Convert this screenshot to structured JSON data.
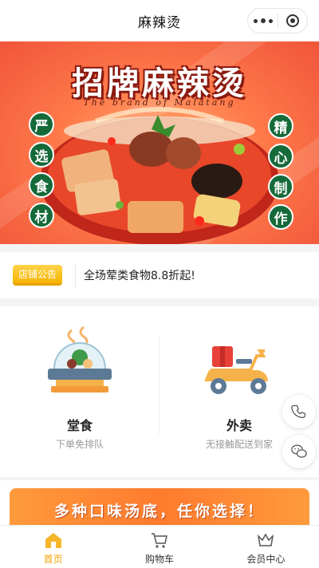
{
  "navbar": {
    "title": "麻辣烫",
    "more_icon": "more-dots-icon",
    "close_icon": "target-close-icon"
  },
  "banner": {
    "headline": "招牌麻辣烫",
    "subtitle": "The brand of Malatang",
    "left_badges": [
      "严",
      "选",
      "食",
      "材"
    ],
    "right_badges": [
      "精",
      "心",
      "制",
      "作"
    ],
    "badge_color": "#156a3a"
  },
  "notice": {
    "tag": "店铺公告",
    "text": "全场荤类食物8.8折起!"
  },
  "services": [
    {
      "name": "堂食",
      "desc": "下单免排队",
      "icon": "dine-in-hotpot-icon"
    },
    {
      "name": "外卖",
      "desc": "无接触配送到家",
      "icon": "delivery-scooter-icon"
    }
  ],
  "floating": {
    "phone_icon": "phone-icon",
    "chat_icon": "chat-icon"
  },
  "promo": {
    "text": "多种口味汤底，任你选择！"
  },
  "tabbar": {
    "active_color": "#f2a200",
    "items": [
      {
        "label": "首页",
        "icon": "home-icon",
        "active": true
      },
      {
        "label": "购物车",
        "icon": "cart-icon",
        "active": false
      },
      {
        "label": "会员中心",
        "icon": "crown-icon",
        "active": false
      }
    ]
  }
}
